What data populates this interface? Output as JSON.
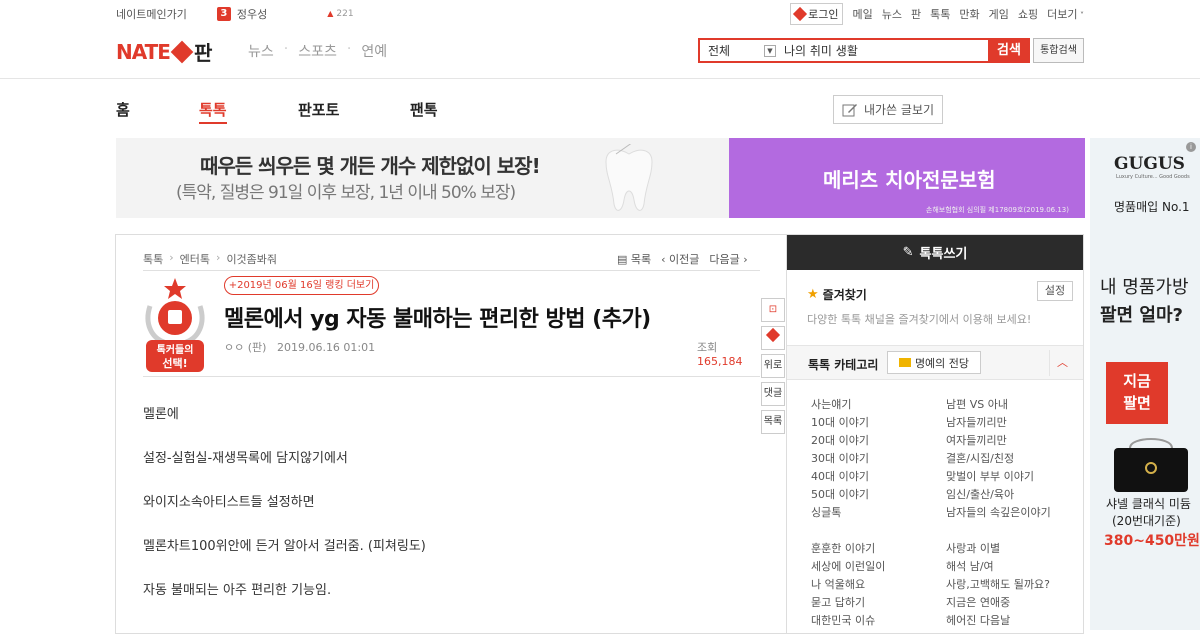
{
  "topbar": {
    "nate_main": "네이트메인가기",
    "rank_badge": "3",
    "trending_name": "정우성",
    "trending_count": "221",
    "login": "로그인",
    "links": [
      "메일",
      "뉴스",
      "판",
      "톡톡",
      "만화",
      "게임",
      "쇼핑",
      "더보기"
    ]
  },
  "header": {
    "logo_text": "NATE",
    "logo_pan": "판",
    "gnb": [
      "뉴스",
      "스포츠",
      "연예"
    ],
    "search_scope": "전체",
    "search_value": "나의 취미 생활",
    "search_button": "검색",
    "total_search": "통합검색"
  },
  "tabs": [
    "홈",
    "톡톡",
    "판포토",
    "팬톡"
  ],
  "my_posts_button": "내가쓴 글보기",
  "ad": {
    "line1": "때우든 씌우든 몇 개든 개수 제한없이 보장!",
    "line2": "(특약, 질병은 91일 이후 보장, 1년 이내 50% 보장)",
    "right_title": "메리츠 치아전문보험",
    "right_small": "손해보험협회 심의필 제17809호(2019.06.13)"
  },
  "side_ad": {
    "brand": "GUGUS",
    "brand_sub": "Luxury Culture... Good Goods",
    "no1": "명품매입 No.1",
    "q1": "내 명품가방",
    "q2": "팔면 얼마?",
    "red1": "지금",
    "red2": "팔면",
    "item1": "샤넬 클래식 미듐",
    "item2": "(20번대기준)",
    "price": "380~450만원"
  },
  "article": {
    "breadcrumb": [
      "톡톡",
      "엔터톡",
      "이것좀봐줘"
    ],
    "nav": [
      "목록",
      "이전글",
      "다음글"
    ],
    "medal_text1": "톡커들의",
    "medal_text2": "선택!",
    "rank_link": "+2019년 06월 16일 랭킹 더보기",
    "title": "멜론에서 yg 자동 불매하는 편리한 방법 (추가)",
    "author": "ㅇㅇ (판)",
    "date": "2019.06.16 01:01",
    "views_label": "조회",
    "views": "165,184",
    "paragraphs": [
      "멜론에",
      "설정-실험실-재생목록에 담지않기에서",
      "와이지소속아티스트들 설정하면",
      "멜론차트100위안에 든거 알아서 걸러줌. (피쳐링도)",
      "자동 불매되는 아주 편리한 기능임."
    ],
    "side_buttons": [
      "위로",
      "댓글",
      "목록"
    ]
  },
  "panel": {
    "write": "톡톡쓰기",
    "fav_title": "즐겨찾기",
    "set": "설정",
    "fav_desc": "다양한 톡톡 채널을 즐겨찾기에서 이용해 보세요!",
    "cat_title": "톡톡 카테고리",
    "hall": "명예의 전당",
    "col1": [
      "사는얘기",
      "10대 이야기",
      "20대 이야기",
      "30대 이야기",
      "40대 이야기",
      "50대 이야기",
      "싱글톡"
    ],
    "col2": [
      "남편 VS 아내",
      "남자들끼리만",
      "여자들끼리만",
      "결혼/시집/친정",
      "맞벌이 부부 이야기",
      "임신/출산/육아",
      "남자들의 속깊은이야기"
    ],
    "col3": [
      "훈훈한 이야기",
      "세상에 이런일이",
      "나 억울해요",
      "묻고 답하기",
      "대한민국 이슈"
    ],
    "col4": [
      "사랑과 이별",
      "해석 남/여",
      "사랑,고백해도 될까요?",
      "지금은 연애중",
      "헤어진 다음날"
    ]
  },
  "colors": {
    "accent": "#e03a2b",
    "ad_purple": "#b36ae0"
  }
}
